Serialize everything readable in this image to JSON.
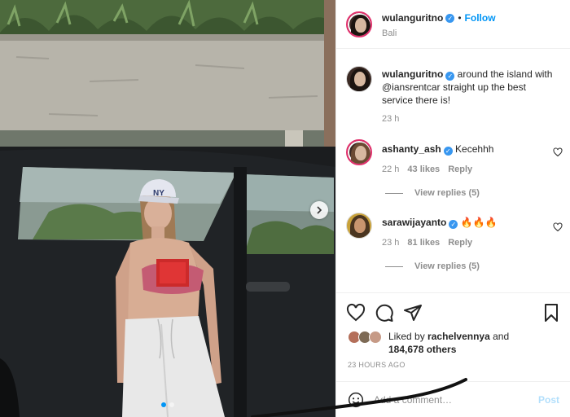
{
  "post": {
    "username": "wulanguritno",
    "follow_label": "Follow",
    "separator": "•",
    "location": "Bali"
  },
  "caption": {
    "username": "wulanguritno",
    "text": "around the island with @iansrentcar straight up the best service there is!",
    "time": "23 h"
  },
  "comments": [
    {
      "username": "ashanty_ash",
      "text": "Kecehhh",
      "time": "22 h",
      "likes": "43 likes",
      "reply_label": "Reply",
      "view_replies": "View replies (5)"
    },
    {
      "username": "sarawijayanto",
      "text": "🔥🔥🔥",
      "time": "23 h",
      "likes": "81 likes",
      "reply_label": "Reply",
      "view_replies": "View replies (5)"
    }
  ],
  "likes": {
    "prefix": "Liked by",
    "user": "rachelvennya",
    "and": "and",
    "others": "184,678 others"
  },
  "timestamp": "23 HOURS AGO",
  "add_comment": {
    "placeholder": "Add a comment…",
    "post_label": "Post"
  },
  "carousel": {
    "slide_count": 2,
    "active_slide": 1
  },
  "colors": {
    "accent": "#0095f6",
    "verified": "#3897f0",
    "post_disabled": "#b2dffc",
    "muted": "#8e8e8e"
  },
  "icons": [
    "heart-icon",
    "comment-icon",
    "share-icon",
    "bookmark-icon",
    "emoji-icon",
    "chevron-right-icon",
    "verified-icon"
  ]
}
